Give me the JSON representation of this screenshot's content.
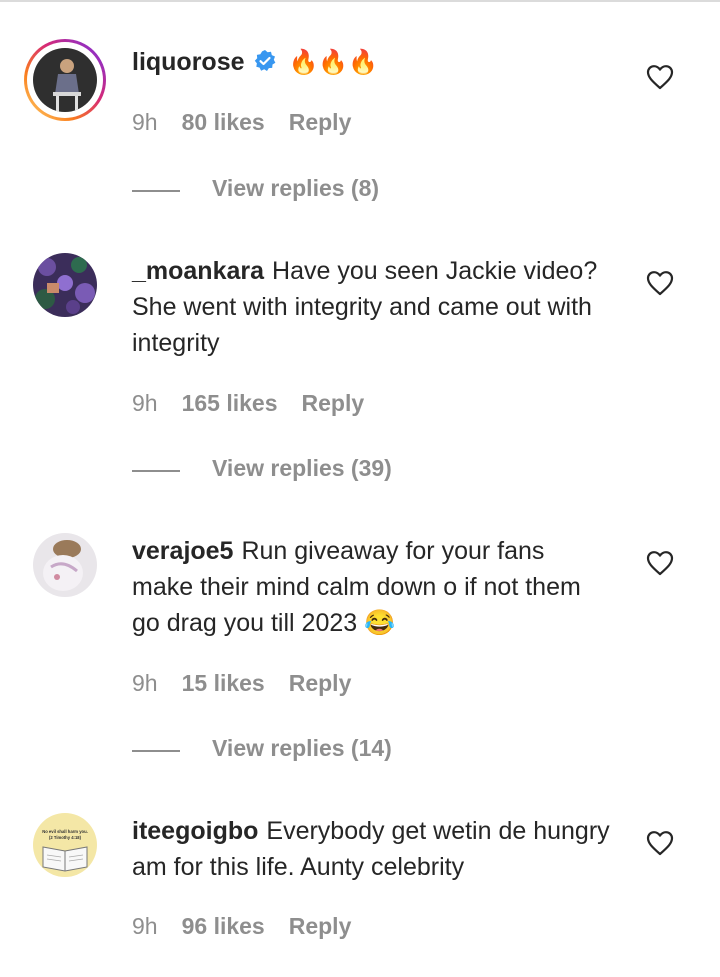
{
  "comments": [
    {
      "username": "liquorose",
      "verified": true,
      "text": "🔥🔥🔥",
      "time": "9h",
      "likes": "80 likes",
      "reply": "Reply",
      "view_replies": "View replies (8)",
      "has_story": true
    },
    {
      "username": "_moankara",
      "text": "Have you seen Jackie video? She went with integrity and came out with integrity",
      "time": "9h",
      "likes": "165 likes",
      "reply": "Reply",
      "view_replies": "View replies (39)"
    },
    {
      "username": "verajoe5",
      "text": "Run giveaway for your fans make their mind calm down o if not them go drag you till 2023 😂",
      "time": "9h",
      "likes": "15 likes",
      "reply": "Reply",
      "view_replies": "View replies (14)"
    },
    {
      "username": "iteegoigbo",
      "text": "Everybody get wetin de hungry am for this life. Aunty celebrity",
      "time": "9h",
      "likes": "96 likes",
      "reply": "Reply",
      "avatar_text": "No evil shall harm you. (2 Timothy 4:18)"
    }
  ],
  "icons": {
    "heart": "heart-outline-icon",
    "verified": "verified-badge-icon"
  },
  "colors": {
    "text": "#262626",
    "meta": "#8e8e8e",
    "verified": "#3897f0"
  }
}
